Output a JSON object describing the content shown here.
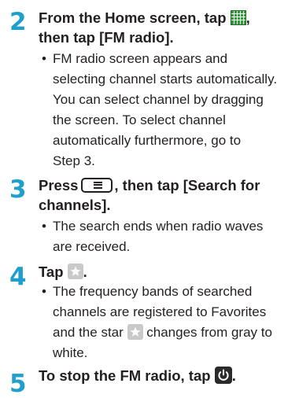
{
  "steps": [
    {
      "number": "2",
      "heading_part1": "From the Home screen, tap",
      "heading_part2": ",",
      "heading_line2": "then tap [FM radio].",
      "heading_icon": "grid-icon",
      "bullet_lines": [
        "FM radio screen appears and",
        "selecting channel starts automatically.",
        "You can select channel by dragging",
        "the screen. To select channel",
        "automatically furthermore, go to",
        "Step 3."
      ]
    },
    {
      "number": "3",
      "heading_part1": "Press",
      "heading_part2": ", then tap [Search for",
      "heading_line2": "channels].",
      "heading_icon": "menu-key-icon",
      "bullet_lines": [
        "The search ends when radio waves",
        "are received."
      ]
    },
    {
      "number": "4",
      "heading_part1": "Tap",
      "heading_part2": ".",
      "heading_icon": "star-icon",
      "bullet_lines": [
        "The frequency bands of searched",
        "channels are registered to Favorites",
        "and the star",
        "changes from gray to",
        "white."
      ]
    },
    {
      "number": "5",
      "heading_part1": "To stop the FM radio, tap",
      "heading_part2": ".",
      "heading_icon": "power-icon"
    }
  ],
  "bullet_symbol": "•",
  "colors": {
    "step_number": "#1f9fcc",
    "text": "#231f20",
    "grid_icon": "#2f9a36",
    "star_background": "#c9c9c9",
    "power_background": "#2b2b2b"
  }
}
